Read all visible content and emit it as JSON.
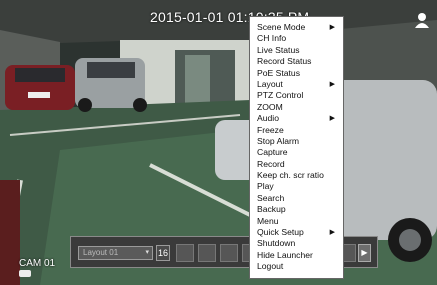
{
  "clock": "2015-01-01 01:10:35 PM",
  "camera_label": "CAM 01",
  "launcher": {
    "layout_select": "Layout 01",
    "layout_button_label": "16"
  },
  "context_menu": [
    {
      "label": "Scene Mode",
      "submenu": true
    },
    {
      "label": "CH Info",
      "submenu": false
    },
    {
      "label": "Live Status",
      "submenu": false
    },
    {
      "label": "Record Status",
      "submenu": false
    },
    {
      "label": "PoE Status",
      "submenu": false
    },
    {
      "label": "Layout",
      "submenu": true
    },
    {
      "label": "PTZ Control",
      "submenu": false
    },
    {
      "label": "ZOOM",
      "submenu": false
    },
    {
      "label": "Audio",
      "submenu": true
    },
    {
      "label": "Freeze",
      "submenu": false
    },
    {
      "label": "Stop Alarm",
      "submenu": false
    },
    {
      "label": "Capture",
      "submenu": false
    },
    {
      "label": "Record",
      "submenu": false
    },
    {
      "label": "Keep ch. scr ratio",
      "submenu": false
    },
    {
      "label": "Play",
      "submenu": false
    },
    {
      "label": "Search",
      "submenu": false
    },
    {
      "label": "Backup",
      "submenu": false
    },
    {
      "label": "Menu",
      "submenu": false
    },
    {
      "label": "Quick Setup",
      "submenu": true
    },
    {
      "label": "Shutdown",
      "submenu": false
    },
    {
      "label": "Hide Launcher",
      "submenu": false
    },
    {
      "label": "Logout",
      "submenu": false
    }
  ],
  "submenu_arrow": "▶",
  "select_arrow": "▾",
  "icons": {
    "user": "user-icon",
    "recording": "record-indicator-icon"
  }
}
